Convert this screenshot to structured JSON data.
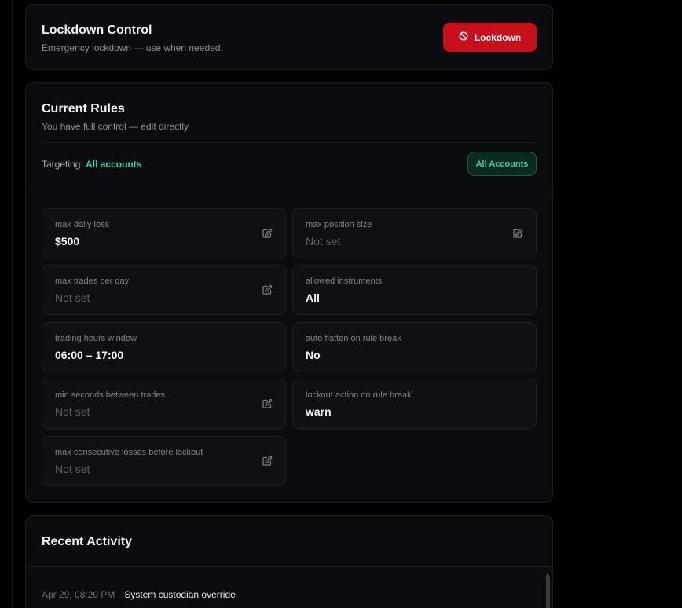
{
  "lockdown": {
    "title": "Lockdown Control",
    "subtitle": "Emergency lockdown — use when needed.",
    "button_label": "Lockdown",
    "button_icon": "ban-icon",
    "button_color": "#c8101a"
  },
  "rules": {
    "title": "Current Rules",
    "subtitle": "You have full control — edit directly",
    "targeting_label": "Targeting:",
    "targeting_value": "All accounts",
    "all_accounts_button": "All Accounts",
    "accent_color": "#2fd3a0",
    "items": [
      {
        "label": "max daily loss",
        "value": "$500",
        "editable": true
      },
      {
        "label": "max position size",
        "value": "Not set",
        "editable": true
      },
      {
        "label": "max trades per day",
        "value": "Not set",
        "editable": true
      },
      {
        "label": "allowed instruments",
        "value": "All",
        "editable": false
      },
      {
        "label": "trading hours window",
        "value": "06:00 – 17:00",
        "editable": false
      },
      {
        "label": "auto flatten on rule break",
        "value": "No",
        "editable": false
      },
      {
        "label": "min seconds between trades",
        "value": "Not set",
        "editable": true
      },
      {
        "label": "lockout action on rule break",
        "value": "warn",
        "editable": false
      },
      {
        "label": "max consecutive losses before lockout",
        "value": "Not set",
        "editable": true
      }
    ]
  },
  "activity": {
    "title": "Recent Activity",
    "entries": [
      {
        "time": "Apr 29, 08:20 PM",
        "text": "System custodian override"
      }
    ]
  }
}
